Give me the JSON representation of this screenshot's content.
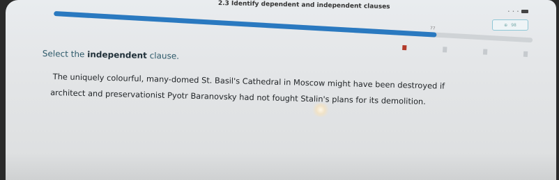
{
  "app": {
    "lesson_title": "2.3 Identify dependent and independent clauses"
  },
  "progress": {
    "value_label": "77",
    "fraction": 0.8
  },
  "top_control": {
    "label_left": "⊕",
    "label_right": "98"
  },
  "question": {
    "prompt_prefix": "Select the ",
    "prompt_emphasis": "independent",
    "prompt_suffix": " clause.",
    "lines": [
      "The uniquely colourful, many-domed St. Basil's Cathedral in Moscow might have been destroyed if",
      "architect and preservationist Pyotr Baranovsky had not fought Stalin's plans for its demolition."
    ]
  },
  "colors": {
    "progress_fill": "#2a79c0",
    "flag": "#b23a2a",
    "prompt_text": "#2e5a6a"
  }
}
